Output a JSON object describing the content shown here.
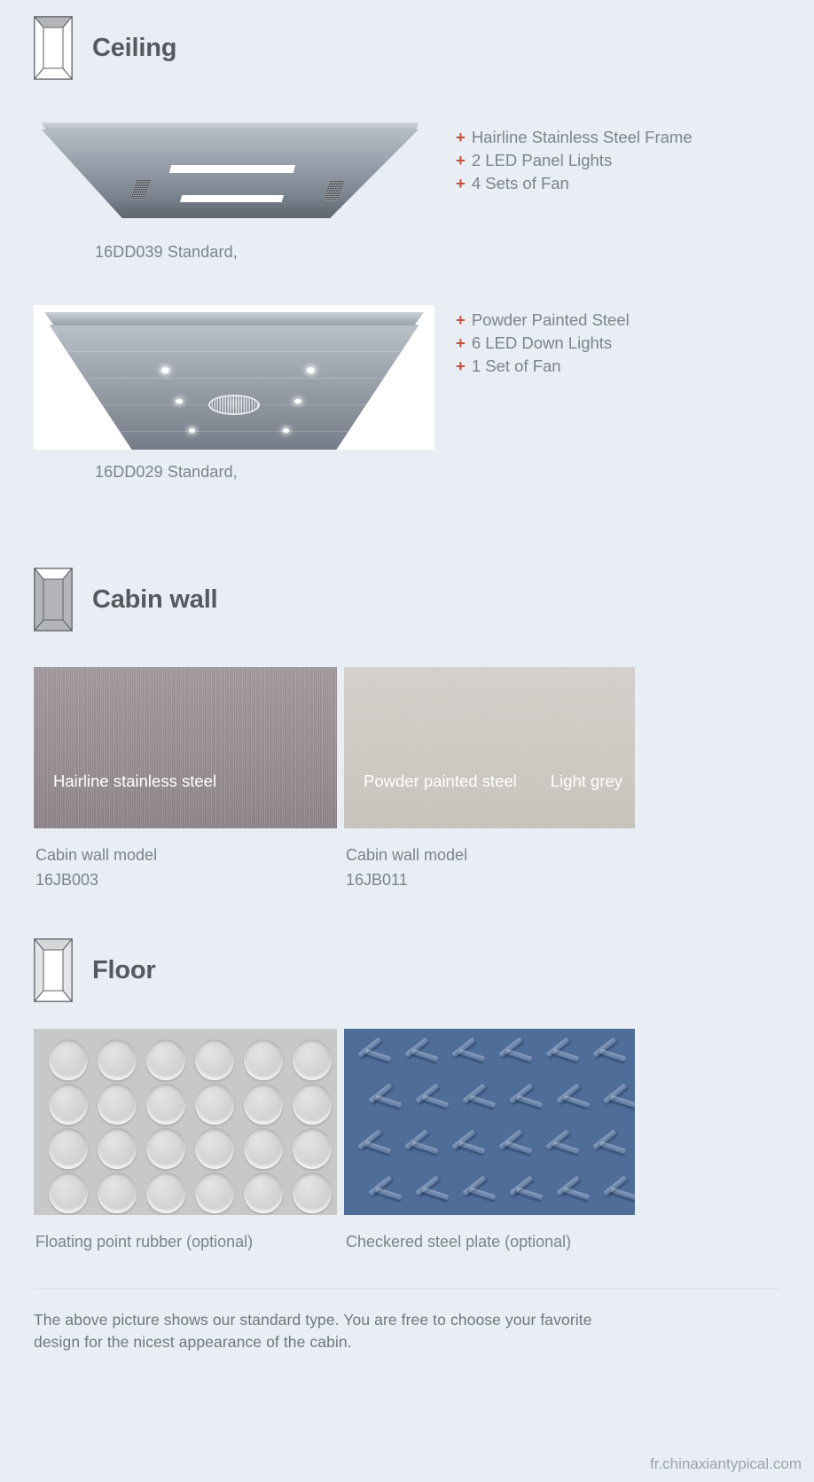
{
  "theme": {
    "background": "#e8eef4",
    "heading_color": "#55595e",
    "text_color": "#7b838b",
    "accent_plus": "#c0503c",
    "checker_blue": "#4f6d99",
    "rubber_grey": "#c6c8ca",
    "hairline_grey": "#9b9297",
    "powder_grey": "#cfcac4"
  },
  "sections": {
    "ceiling": {
      "title": "Ceiling",
      "icon": "cabin-frame-ceiling-icon",
      "items": [
        {
          "caption": "16DD039 Standard,",
          "features": [
            "Hairline Stainless Steel Frame",
            "2 LED Panel Lights",
            "4 Sets of Fan"
          ]
        },
        {
          "caption": "16DD029 Standard,",
          "features": [
            "Powder Painted Steel",
            "6 LED Down Lights",
            "1 Set of Fan"
          ]
        }
      ]
    },
    "cabin_wall": {
      "title": "Cabin wall",
      "icon": "cabin-frame-wall-icon",
      "swatches": [
        {
          "overlay_labels": [
            "Hairline stainless steel"
          ],
          "caption_line1": "Cabin wall model",
          "caption_line2": "16JB003"
        },
        {
          "overlay_labels": [
            "Powder painted steel",
            "Light grey"
          ],
          "caption_line1": "Cabin wall model",
          "caption_line2": "16JB011"
        }
      ]
    },
    "floor": {
      "title": "Floor",
      "icon": "cabin-frame-floor-icon",
      "swatches": [
        {
          "caption": "Floating point rubber (optional)"
        },
        {
          "caption": "Checkered steel plate (optional)"
        }
      ]
    }
  },
  "footer": {
    "note": "The above picture shows our standard type. You are free to choose your favorite design for the nicest appearance of the cabin.",
    "watermark": "fr.chinaxiantypical.com"
  },
  "plus_symbol": "+"
}
